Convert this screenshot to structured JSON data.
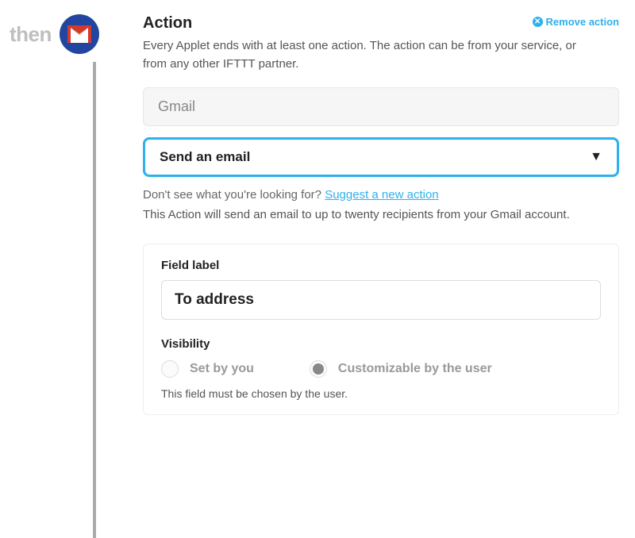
{
  "left": {
    "then_label": "then",
    "service_icon": "gmail-icon"
  },
  "header": {
    "title": "Action",
    "remove_label": "Remove action"
  },
  "description": "Every Applet ends with at least one action. The action can be from your service, or from any other IFTTT partner.",
  "service_input": {
    "value": "Gmail"
  },
  "action_select": {
    "selected": "Send an email"
  },
  "suggest": {
    "prefix": "Don't see what you're looking for?  ",
    "link": "Suggest a new action"
  },
  "action_note": "This Action will send an email to up to twenty recipients from your Gmail account.",
  "field": {
    "label_title": "Field label",
    "input_value": "To address",
    "visibility_title": "Visibility",
    "options": {
      "set_by_you": "Set by you",
      "customizable": "Customizable by the user"
    },
    "note": "This field must be chosen by the user."
  }
}
